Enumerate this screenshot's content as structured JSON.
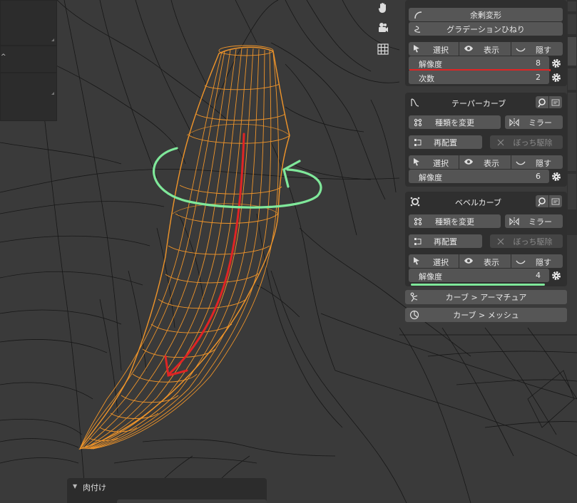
{
  "modifiers_top": {
    "excess_deform_label": "余剰変形",
    "gradation_twist_label": "グラデーションひねり",
    "select_label": "選択",
    "display_label": "表示",
    "hide_label": "隠す",
    "resolution_label": "解像度",
    "resolution_value": "8",
    "order_label": "次数",
    "order_value": "2"
  },
  "taper_curve": {
    "title": "テーパーカーブ",
    "change_type_label": "種類を変更",
    "mirror_label": "ミラー",
    "rearrange_label": "再配置",
    "remove_isolated_label": "ぼっち駆除",
    "select_label": "選択",
    "display_label": "表示",
    "hide_label": "隠す",
    "resolution_label": "解像度",
    "resolution_value": "6"
  },
  "bevel_curve": {
    "title": "ベベルカーブ",
    "change_type_label": "種類を変更",
    "mirror_label": "ミラー",
    "rearrange_label": "再配置",
    "remove_isolated_label": "ぼっち駆除",
    "select_label": "選択",
    "display_label": "表示",
    "hide_label": "隠す",
    "resolution_label": "解像度",
    "resolution_value": "4"
  },
  "conversions": {
    "curve_to_armature_label": "カーブ > アーマチュア",
    "curve_to_mesh_label": "カーブ > メッシュ"
  },
  "bottom_panel": {
    "title": "肉付け"
  },
  "colors": {
    "viewport_bg": "#3a3a3a",
    "panel_bg": "#2f2f2f",
    "button_bg": "#565656",
    "wire_orange": "#f0952a",
    "annotation_red": "#e02424",
    "annotation_green": "#7fe89a"
  },
  "icons": {
    "hand": "hand-icon",
    "camera": "camera-icon",
    "grid": "grid-icon"
  }
}
